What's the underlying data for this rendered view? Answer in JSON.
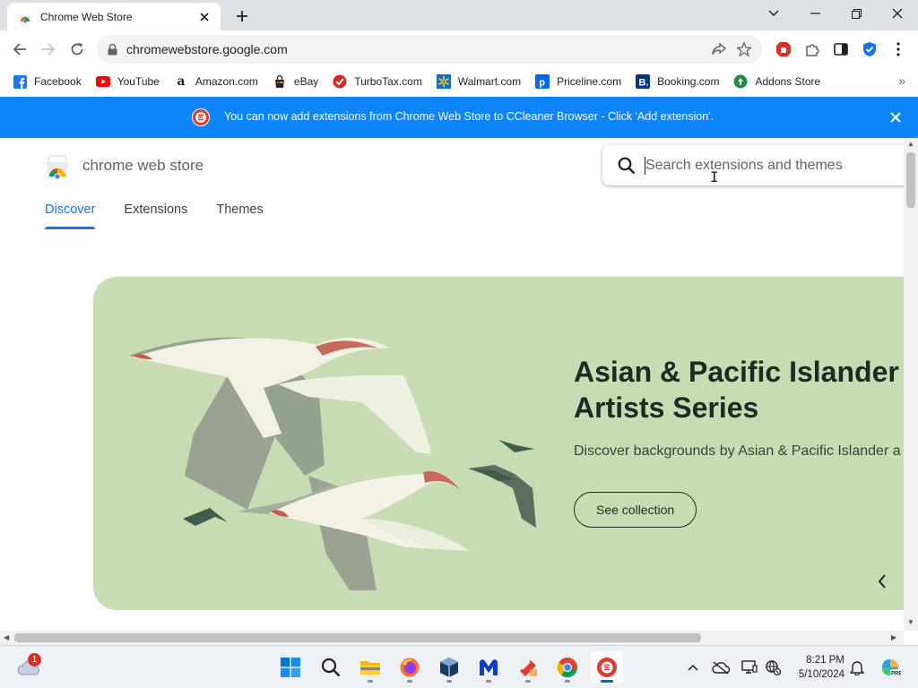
{
  "browser": {
    "tab_title": "Chrome Web Store",
    "url": "chromewebstore.google.com"
  },
  "bookmarks": [
    {
      "label": "Facebook",
      "icon": "facebook-icon",
      "color": "#1877f2"
    },
    {
      "label": "YouTube",
      "icon": "youtube-icon",
      "color": "#ff0000"
    },
    {
      "label": "Amazon.com",
      "icon": "amazon-icon",
      "color": "#000000"
    },
    {
      "label": "eBay",
      "icon": "ebay-icon",
      "color": "#e53238"
    },
    {
      "label": "TurboTax.com",
      "icon": "turbotax-icon",
      "color": "#d52b1e"
    },
    {
      "label": "Walmart.com",
      "icon": "walmart-icon",
      "color": "#0071ce"
    },
    {
      "label": "Priceline.com",
      "icon": "priceline-icon",
      "color": "#0068ef"
    },
    {
      "label": "Booking.com",
      "icon": "booking-icon",
      "color": "#003580"
    },
    {
      "label": "Addons Store",
      "icon": "addons-store-icon",
      "color": "#1e8e3e"
    }
  ],
  "infobar": {
    "message": "You can now add extensions from Chrome Web Store to CCleaner Browser - Click 'Add extension'.",
    "color": "#0d84f7"
  },
  "store": {
    "name": "chrome web store",
    "search_placeholder": "Search extensions and themes",
    "tabs": [
      {
        "label": "Discover",
        "active": true
      },
      {
        "label": "Extensions",
        "active": false
      },
      {
        "label": "Themes",
        "active": false
      }
    ],
    "banner": {
      "title": "Asian & Pacific Islander Artists Series",
      "subtitle": "Discover backgrounds by Asian & Pacific Islander a",
      "button": "See collection",
      "background": "#c7dcb3"
    }
  },
  "taskbar": {
    "weather_badge": "1",
    "time": "8:21 PM",
    "date": "5/10/2024",
    "apps": [
      "start-icon",
      "search-icon",
      "file-explorer-icon",
      "firefox-icon",
      "virtualbox-icon",
      "malwarebytes-icon",
      "ccleaner-icon",
      "chrome-icon",
      "ccleaner-browser-icon"
    ]
  }
}
